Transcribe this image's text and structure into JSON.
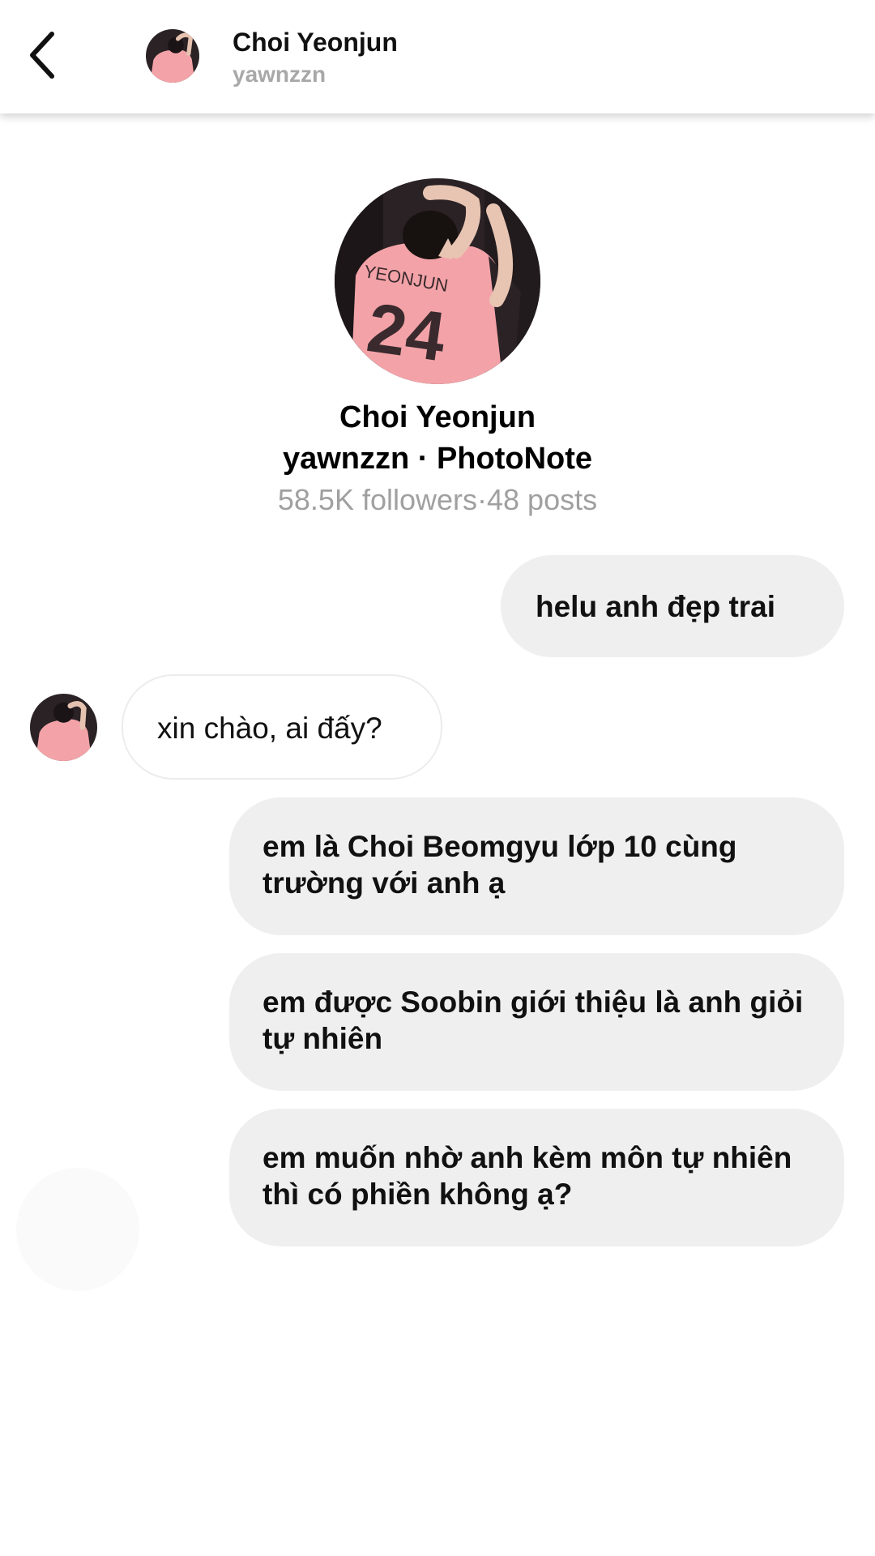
{
  "header": {
    "name": "Choi Yeonjun",
    "username": "yawnzzn",
    "back_icon": "chevron-left-icon"
  },
  "profile": {
    "name": "Choi Yeonjun",
    "meta": "yawnzzn · PhotoNote",
    "stats": "58.5K followers·48 posts",
    "jersey_text": "YEONJUN",
    "jersey_number": "24"
  },
  "messages": [
    {
      "direction": "outgoing",
      "text": "helu anh đẹp trai"
    },
    {
      "direction": "incoming",
      "text": "xin chào, ai đấy?"
    },
    {
      "direction": "outgoing",
      "text": "em là Choi Beomgyu lớp 10 cùng trường với anh ạ"
    },
    {
      "direction": "outgoing",
      "text": "em được Soobin giới thiệu là anh giỏi tự nhiên"
    },
    {
      "direction": "outgoing",
      "text": "em muốn nhờ anh kèm môn tự nhiên thì có phiền không ạ?"
    }
  ],
  "colors": {
    "outgoing_bubble": "#efefef",
    "incoming_border": "#ececec",
    "secondary_text": "#a8a8a8",
    "background": "#ffffff",
    "jersey_pink": "#f3a3a8",
    "photo_dark": "#2a2224"
  }
}
